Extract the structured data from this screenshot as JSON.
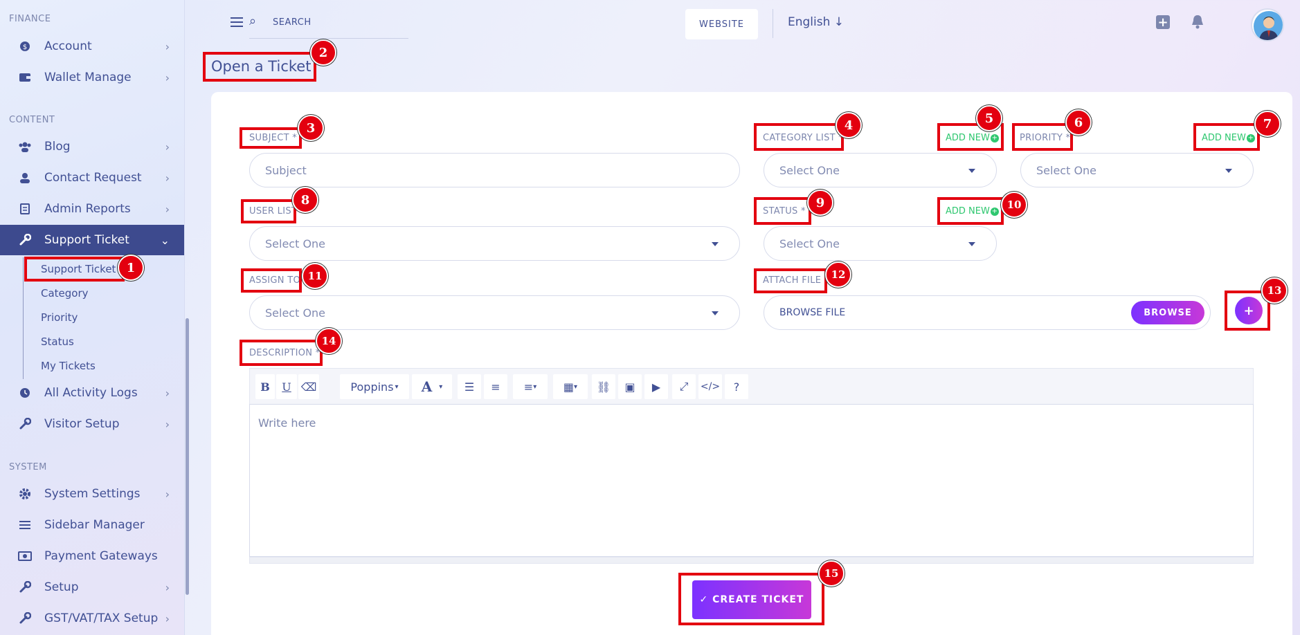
{
  "sidebar": {
    "sections": {
      "finance": "FINANCE",
      "content": "CONTENT",
      "system": "SYSTEM"
    },
    "items": {
      "account": "Account",
      "wallet": "Wallet Manage",
      "blog": "Blog",
      "contact": "Contact Request",
      "reports": "Admin Reports",
      "support": "Support Ticket",
      "activity": "All Activity Logs",
      "visitor": "Visitor Setup",
      "settings": "System Settings",
      "sidebar_mgr": "Sidebar Manager",
      "payment": "Payment Gateways",
      "setup": "Setup",
      "gst": "GST/VAT/TAX Setup"
    },
    "sub": {
      "ticket": "Support Ticket",
      "category": "Category",
      "priority": "Priority",
      "status": "Status",
      "my": "My Tickets"
    }
  },
  "header": {
    "search_placeholder": "SEARCH",
    "website": "WEBSITE",
    "language": "English ↓"
  },
  "page": {
    "title": "Open a Ticket"
  },
  "form": {
    "subject_label": "SUBJECT *",
    "subject_placeholder": "Subject",
    "category_label": "CATEGORY LIST *",
    "priority_label": "PRIORITY *",
    "user_label": "USER LIST",
    "status_label": "STATUS *",
    "assign_label": "ASSIGN TO",
    "attach_label": "ATTACH FILE",
    "description_label": "DESCRIPTION *",
    "add_new": "ADD NEW",
    "select_one": "Select One",
    "browse_file": "BROWSE FILE",
    "browse": "BROWSE",
    "plus": "+",
    "editor_placeholder": "Write here",
    "font": "Poppins",
    "submit": "✓ CREATE TICKET"
  },
  "annotations": [
    "1",
    "2",
    "3",
    "4",
    "5",
    "6",
    "7",
    "8",
    "9",
    "10",
    "11",
    "12",
    "13",
    "14",
    "15"
  ],
  "colors": {
    "accent_from": "#7c32ff",
    "accent_to": "#c738d8",
    "active_nav": "#3d4a8e",
    "annotation": "#e3000f",
    "add_new": "#2ec76f"
  }
}
